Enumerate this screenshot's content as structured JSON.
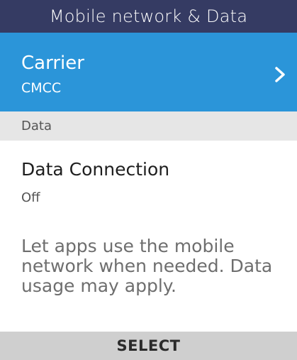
{
  "header": {
    "title": "Mobile network & Data"
  },
  "carrier": {
    "title": "Carrier",
    "value": "CMCC",
    "chevron_icon": "chevron-right-icon"
  },
  "section": {
    "label": "Data"
  },
  "data_connection": {
    "title": "Data Connection",
    "value": "Off"
  },
  "description": {
    "text": "Let apps use the mobile network when needed. Data usage may apply."
  },
  "softkeys": {
    "center_label": "SELECT"
  },
  "colors": {
    "header_bg": "#353b63",
    "selected_bg": "#2b95d9",
    "section_bg": "#e6e6e6",
    "softkey_bg": "#cfcfcf"
  }
}
